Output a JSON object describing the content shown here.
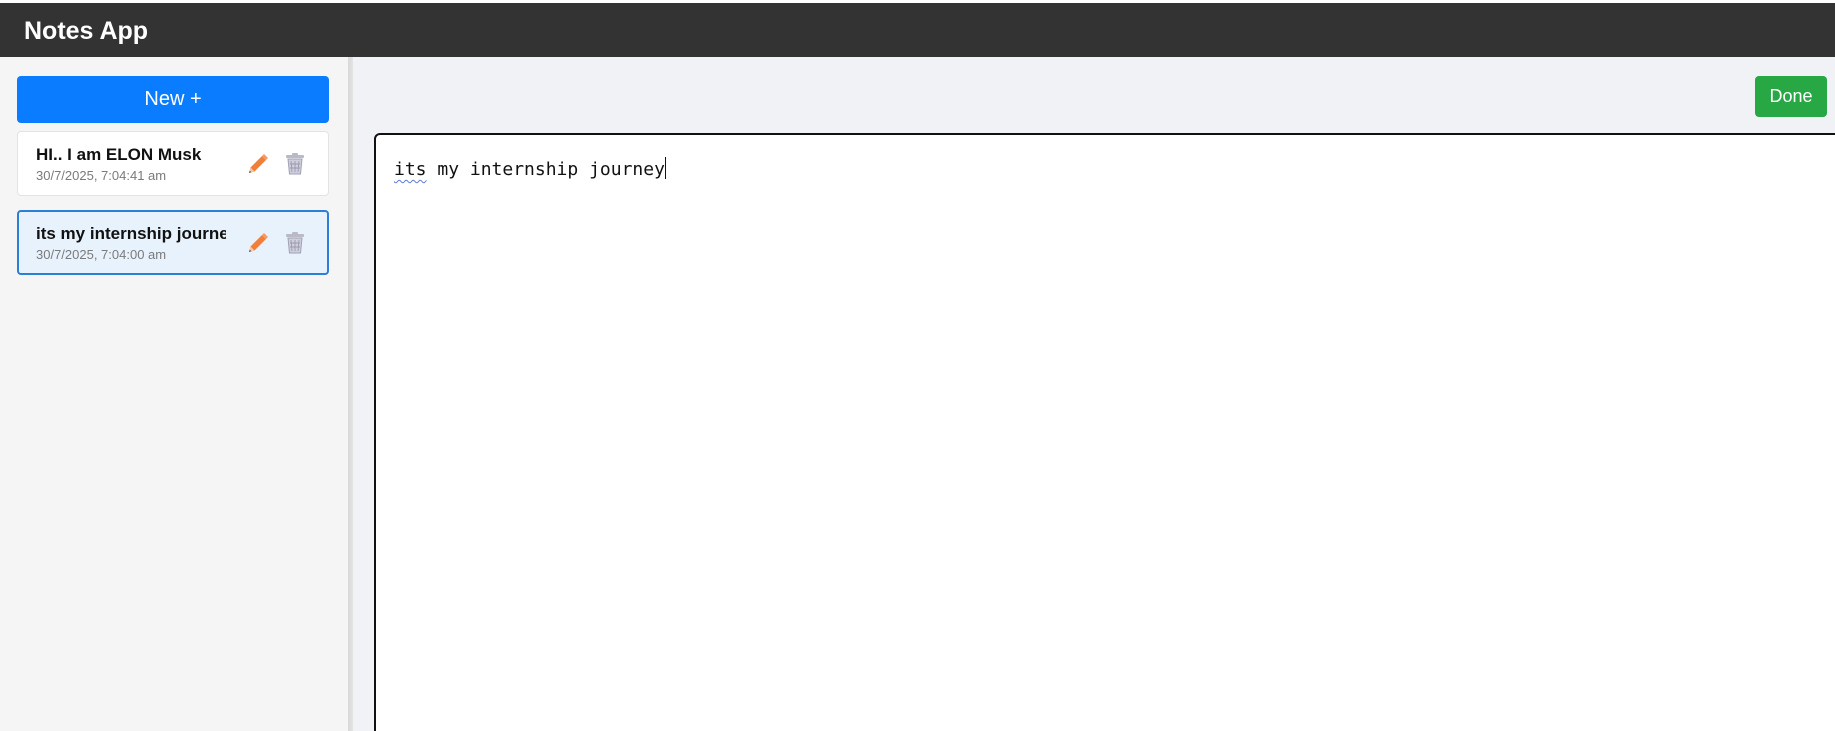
{
  "app": {
    "title": "Notes App"
  },
  "sidebar": {
    "new_button_label": "New +",
    "notes": [
      {
        "title": "HI.. I am ELON Musk",
        "date": "30/7/2025, 7:04:41 am",
        "active": false
      },
      {
        "title": "its my internship journey",
        "date": "30/7/2025, 7:04:00 am",
        "active": true
      }
    ]
  },
  "main": {
    "done_button_label": "Done",
    "editor": {
      "misspelled_word": "its",
      "rest_text": " my internship journey"
    }
  },
  "icons": {
    "edit": "pencil-icon",
    "delete": "trash-icon"
  },
  "colors": {
    "topbar": "#333333",
    "primary": "#0a7cff",
    "success": "#28a745",
    "active_border": "#2b7fd6",
    "active_bg": "#e8f2fd",
    "pencil": "#f07f3c",
    "trash": "#a8a8b8"
  }
}
